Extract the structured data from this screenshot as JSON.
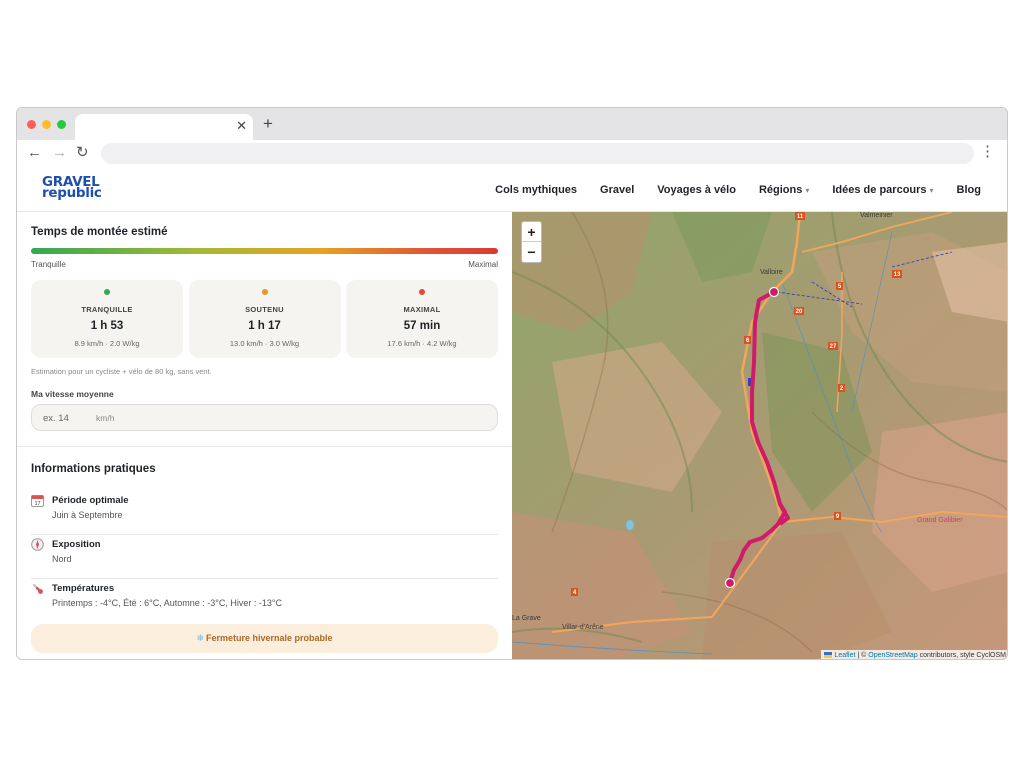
{
  "header": {
    "logo_line1": "GRAVEL",
    "logo_line2": "republic",
    "nav": [
      {
        "label": "Cols mythiques",
        "dropdown": false
      },
      {
        "label": "Gravel",
        "dropdown": false
      },
      {
        "label": "Voyages à vélo",
        "dropdown": false
      },
      {
        "label": "Régions",
        "dropdown": true
      },
      {
        "label": "Idées de parcours",
        "dropdown": true
      },
      {
        "label": "Blog",
        "dropdown": false
      }
    ]
  },
  "climb_time": {
    "title": "Temps de montée estimé",
    "scale_left": "Tranquille",
    "scale_right": "Maximal",
    "cards": [
      {
        "label": "TRANQUILLE",
        "time": "1 h 53",
        "detail": "8.9 km/h · 2.0 W/kg",
        "color": "#34a853"
      },
      {
        "label": "SOUTENU",
        "time": "1 h 17",
        "detail": "13.0 km/h · 3.0 W/kg",
        "color": "#e8952a"
      },
      {
        "label": "MAXIMAL",
        "time": "57 min",
        "detail": "17.6 km/h · 4.2 W/kg",
        "color": "#e04a3a"
      }
    ],
    "note": "Estimation pour un cycliste + vélo de 80 kg, sans vent.",
    "speed_label": "Ma vitesse moyenne",
    "speed_placeholder": "ex. 14",
    "speed_unit": "km/h"
  },
  "info": {
    "title": "Informations pratiques",
    "rows": [
      {
        "icon": "calendar-icon",
        "title": "Période optimale",
        "value": "Juin à Septembre"
      },
      {
        "icon": "compass-icon",
        "title": "Exposition",
        "value": "Nord"
      },
      {
        "icon": "thermometer-icon",
        "title": "Températures",
        "value": "Printemps : -4°C, Été : 6°C, Automne : -3°C, Hiver : -13°C"
      }
    ],
    "warning": "Fermeture hivernale probable"
  },
  "map": {
    "zoom_in": "+",
    "zoom_out": "−",
    "attribution_leaflet": "Leaflet",
    "attribution_sep": " | © ",
    "attribution_osm": "OpenStreetMap",
    "attribution_rest": " contributors, style CyclOSM",
    "places": [
      "Valloire",
      "Valmeinier",
      "La Grave",
      "Villar-d'Arêne",
      "Grand Galibier"
    ],
    "road_numbers": [
      "11",
      "13",
      "6",
      "20",
      "5",
      "27",
      "2",
      "9",
      "4"
    ],
    "route_color": "#d01a6a"
  }
}
